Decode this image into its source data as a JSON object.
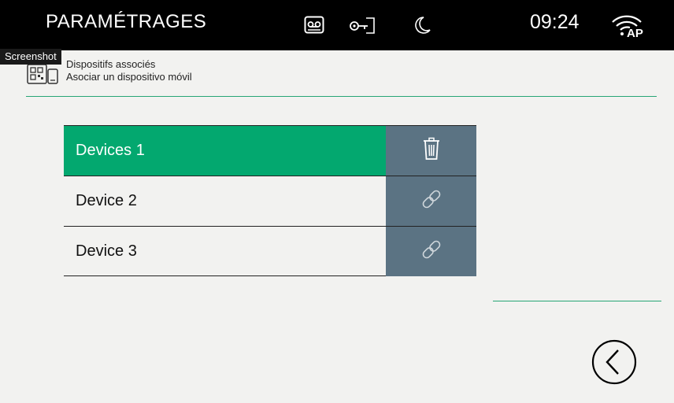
{
  "topbar": {
    "title": "PARAMÉTRAGES",
    "time": "09:24",
    "icons": [
      "voicemail-icon",
      "door-key-icon",
      "moon-icon",
      "wifi-ap-icon"
    ],
    "wifi_label": "AP"
  },
  "tooltip": {
    "text": "Screenshot"
  },
  "header": {
    "icon": "qr-device-icon",
    "line1": "Dispositifs associés",
    "line2": "Asociar un dispositivo móvil"
  },
  "devices": [
    {
      "name": "Devices 1",
      "selected": true,
      "action_icon": "trash-icon"
    },
    {
      "name": "Device 2",
      "selected": false,
      "action_icon": "link-icon"
    },
    {
      "name": "Device 3",
      "selected": false,
      "action_icon": "link-icon"
    }
  ],
  "colors": {
    "accent_green": "#03a86f",
    "action_bg": "#5b7383",
    "topbar_bg": "#000000",
    "page_bg": "#f2f2f0",
    "divider_green": "#27a575"
  },
  "back_button": {
    "icon": "chevron-left-circle-icon"
  }
}
